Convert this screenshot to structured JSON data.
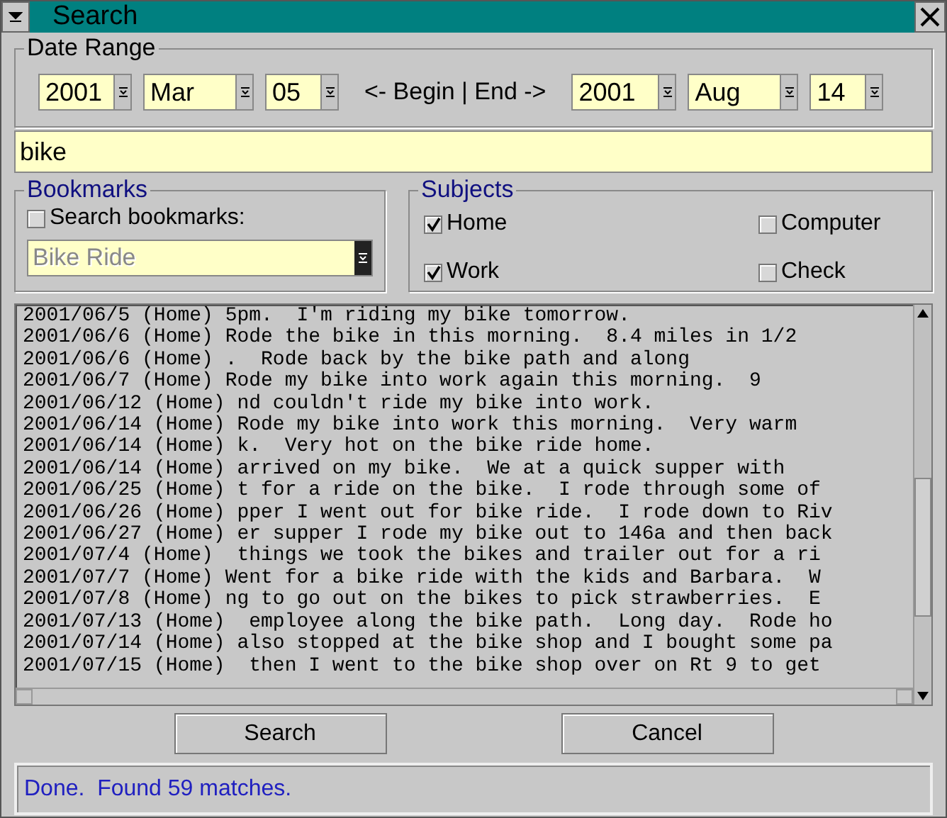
{
  "window": {
    "title": "Search"
  },
  "date_range": {
    "title": "Date Range",
    "begin": [
      {
        "value": "2001"
      },
      {
        "value": "Mar"
      },
      {
        "value": "05"
      }
    ],
    "separator": "<- Begin | End ->",
    "end": [
      {
        "value": "2001"
      },
      {
        "value": "Aug"
      },
      {
        "value": "14"
      }
    ]
  },
  "search_field": {
    "value": "bike"
  },
  "bookmarks": {
    "title": "Bookmarks",
    "checkbox": {
      "label": "Search bookmarks:",
      "checked": false
    },
    "combo": {
      "value": "Bike Ride",
      "disabled": true
    }
  },
  "subjects": {
    "title": "Subjects",
    "items": [
      {
        "label": "Home",
        "checked": true
      },
      {
        "label": "Computer",
        "checked": false
      },
      {
        "label": "Work",
        "checked": true
      },
      {
        "label": "Check",
        "checked": false
      }
    ]
  },
  "results": [
    "2001/06/5 (Home) 5pm.  I'm riding my bike tomorrow.",
    "2001/06/6 (Home) Rode the bike in this morning.  8.4 miles in 1/2",
    "2001/06/6 (Home) .  Rode back by the bike path and along",
    "2001/06/7 (Home) Rode my bike into work again this morning.  9",
    "2001/06/12 (Home) nd couldn't ride my bike into work.",
    "2001/06/14 (Home) Rode my bike into work this morning.  Very warm",
    "2001/06/14 (Home) k.  Very hot on the bike ride home.",
    "2001/06/14 (Home) arrived on my bike.  We at a quick supper with",
    "2001/06/25 (Home) t for a ride on the bike.  I rode through some of",
    "2001/06/26 (Home) pper I went out for bike ride.  I rode down to Riv",
    "2001/06/27 (Home) er supper I rode my bike out to 146a and then back",
    "2001/07/4 (Home)  things we took the bikes and trailer out for a ri",
    "2001/07/7 (Home) Went for a bike ride with the kids and Barbara.  W",
    "2001/07/8 (Home) ng to go out on the bikes to pick strawberries.  E",
    "2001/07/13 (Home)  employee along the bike path.  Long day.  Rode ho",
    "2001/07/14 (Home) also stopped at the bike shop and I bought some pa",
    "2001/07/15 (Home)  then I went to the bike shop over on Rt 9 to get"
  ],
  "buttons": [
    "Search",
    "Cancel"
  ],
  "status": "Done.  Found 59 matches."
}
